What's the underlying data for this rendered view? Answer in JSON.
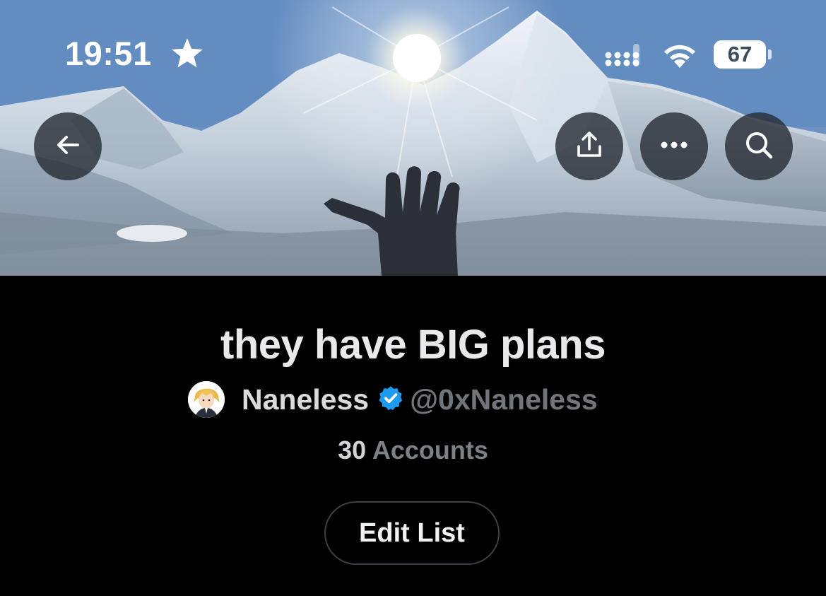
{
  "status_bar": {
    "time": "19:51",
    "battery_level": "67"
  },
  "header": {
    "banner_description_icon": "mountain-banner-image",
    "buttons": {
      "back": "back-arrow-icon",
      "share": "share-icon",
      "more": "more-icon",
      "search": "search-icon"
    }
  },
  "list": {
    "title": "they have BIG plans",
    "owner_name": "Naneless",
    "owner_handle": "@0xNaneless",
    "account_count": "30",
    "account_label": "Accounts",
    "edit_label": "Edit List"
  },
  "colors": {
    "background": "#000000",
    "verified": "#1d9bf0",
    "secondary_text": "#71767b"
  }
}
